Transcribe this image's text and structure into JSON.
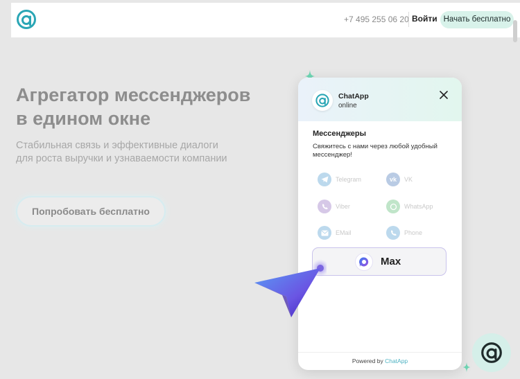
{
  "header": {
    "phone": "+7 495 255 06 20",
    "login_label": "Войти",
    "start_label": "Начать бесплатно"
  },
  "hero": {
    "title_line1": "Агрегатор мессенджеров",
    "title_line2": "в едином окне",
    "subtitle_line1": "Стабильная связь и эффективные диалоги",
    "subtitle_line2": "для роста выручки и узнаваемости компании",
    "cta_label": "Попробовать бесплатно"
  },
  "widget": {
    "name": "ChatApp",
    "status": "online",
    "section_title": "Мессенджеры",
    "section_text": "Свяжитесь с нами через любой удобный мессенджер!",
    "messengers": [
      {
        "label": "Telegram",
        "icon": "telegram-icon",
        "color": "#b9d7ec"
      },
      {
        "label": "VK",
        "icon": "vk-icon",
        "color": "#b8cbe4"
      },
      {
        "label": "Viber",
        "icon": "viber-icon",
        "color": "#d5c6e6"
      },
      {
        "label": "WhatsApp",
        "icon": "whatsapp-icon",
        "color": "#bfe4c8"
      },
      {
        "label": "EMail",
        "icon": "mail-icon",
        "color": "#b9d7ec"
      },
      {
        "label": "Phone",
        "icon": "phone-icon",
        "color": "#b9d7ec"
      }
    ],
    "max_label": "Max",
    "powered_prefix": "Powered by",
    "powered_brand": "ChatApp"
  },
  "colors": {
    "accent_teal": "#2aa6b5",
    "button_mint": "#d8f2ea",
    "max_purple": "#6a4fd8"
  }
}
